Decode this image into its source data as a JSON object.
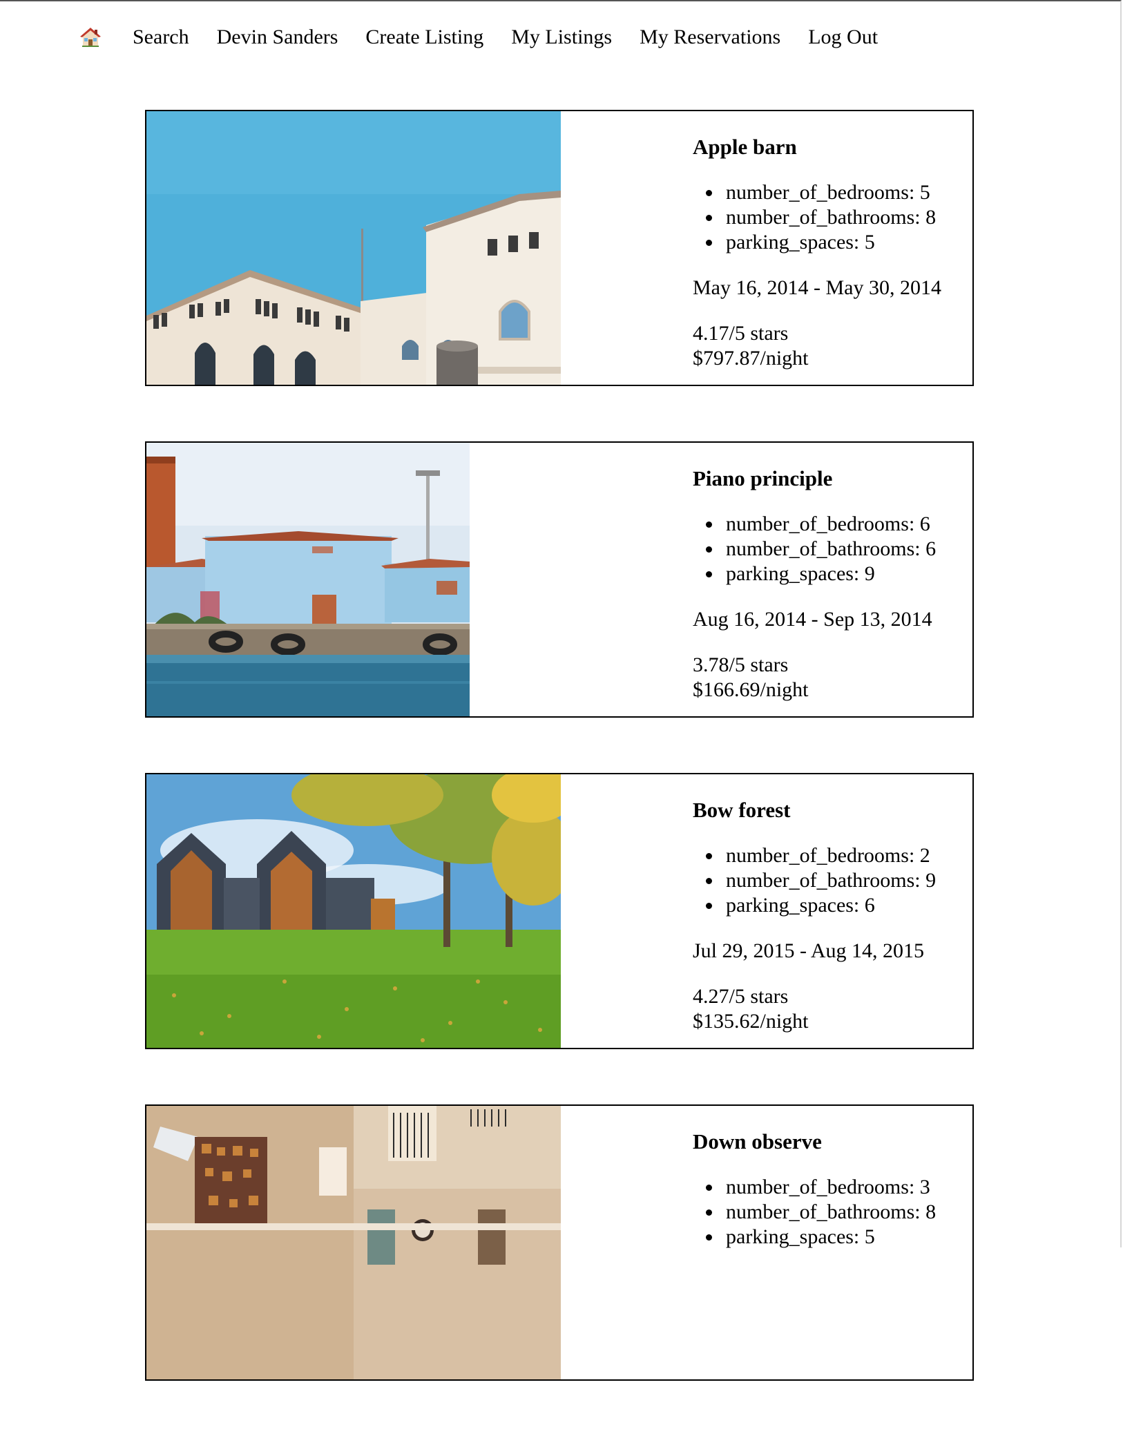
{
  "nav": {
    "home_icon": "house-icon",
    "links": [
      {
        "label": "Search"
      },
      {
        "label": "Devin Sanders"
      },
      {
        "label": "Create Listing"
      },
      {
        "label": "My Listings"
      },
      {
        "label": "My Reservations"
      },
      {
        "label": "Log Out"
      }
    ]
  },
  "listings": [
    {
      "title": "Apple barn",
      "specs": [
        "number_of_bedrooms: 5",
        "number_of_bathrooms: 8",
        "parking_spaces: 5"
      ],
      "dates": "May 16, 2014 - May 30, 2014",
      "rating": "4.17/5 stars",
      "price": "$797.87/night",
      "photo": "white-arched-building"
    },
    {
      "title": "Piano principle",
      "specs": [
        "number_of_bedrooms: 6",
        "number_of_bathrooms: 6",
        "parking_spaces: 9"
      ],
      "dates": "Aug 16, 2014 - Sep 13, 2014",
      "rating": "3.78/5 stars",
      "price": "$166.69/night",
      "photo": "blue-waterfront-building"
    },
    {
      "title": "Bow forest",
      "specs": [
        "number_of_bedrooms: 2",
        "number_of_bathrooms: 9",
        "parking_spaces: 6"
      ],
      "dates": "Jul 29, 2015 - Aug 14, 2015",
      "rating": "4.27/5 stars",
      "price": "$135.62/night",
      "photo": "modern-barn-houses-lawn"
    },
    {
      "title": "Down observe",
      "specs": [
        "number_of_bedrooms: 3",
        "number_of_bathrooms: 8",
        "parking_spaces: 5"
      ],
      "photo": "living-room-interior"
    }
  ]
}
